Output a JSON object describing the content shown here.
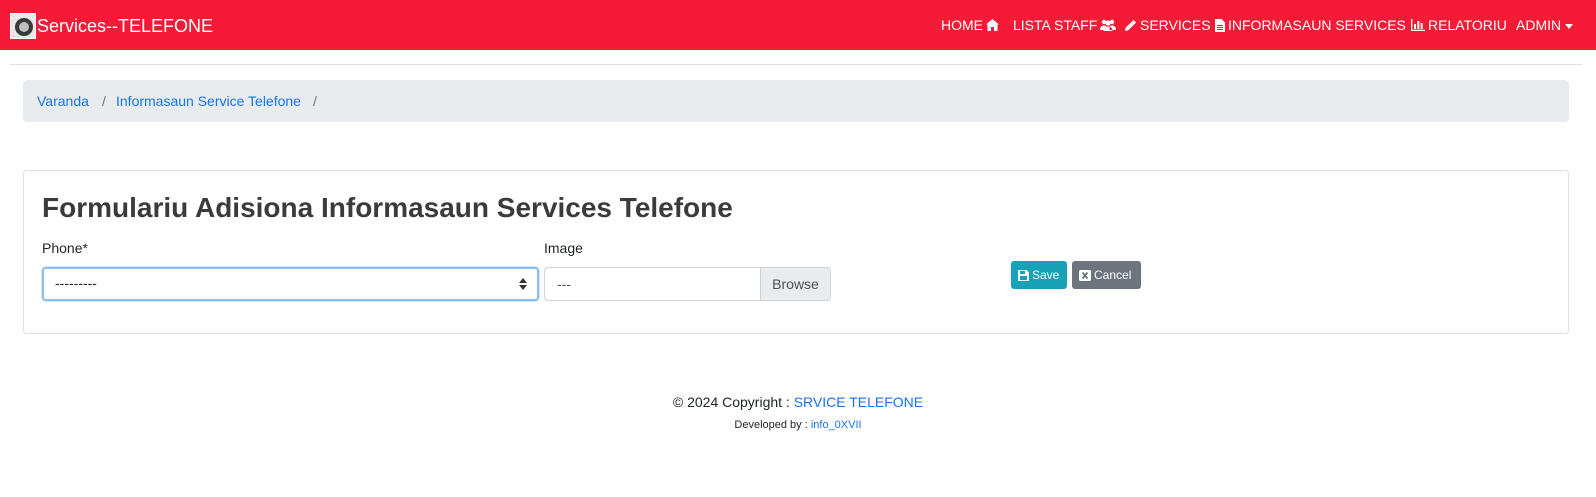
{
  "navbar": {
    "brand": "Services--TELEFONE",
    "items": [
      {
        "label": "HOME",
        "icon": "home-icon"
      },
      {
        "label": "LISTA STAFF",
        "icon": "users-icon"
      },
      {
        "label": "SERVICES",
        "icon": "pencil-icon"
      },
      {
        "label": "INFORMASAUN SERVICES",
        "icon": "file-icon"
      },
      {
        "label": "RELATORIU",
        "icon": "bar-chart-icon"
      },
      {
        "label": "ADMIN",
        "icon": "caret-down-icon"
      }
    ]
  },
  "breadcrumb": {
    "items": [
      "Varanda",
      "Informasaun Service Telefone"
    ],
    "separator": "/"
  },
  "form": {
    "title": "Formulariu Adisiona Informasaun Services Telefone",
    "phone_label": "Phone*",
    "phone_value": "---------",
    "image_label": "Image",
    "image_value": "---",
    "browse_label": "Browse",
    "save_label": "Save",
    "cancel_label": "Cancel"
  },
  "footer": {
    "copyright_prefix": "© 2024 Copyright : ",
    "copyright_link": "SRVICE TELEFONE",
    "developed_prefix": "Developed by : ",
    "developer": "info_0XVII"
  },
  "colors": {
    "navbar": "#f51b37",
    "link": "#1a73e8",
    "save": "#17a2b8",
    "cancel": "#6c757d"
  }
}
